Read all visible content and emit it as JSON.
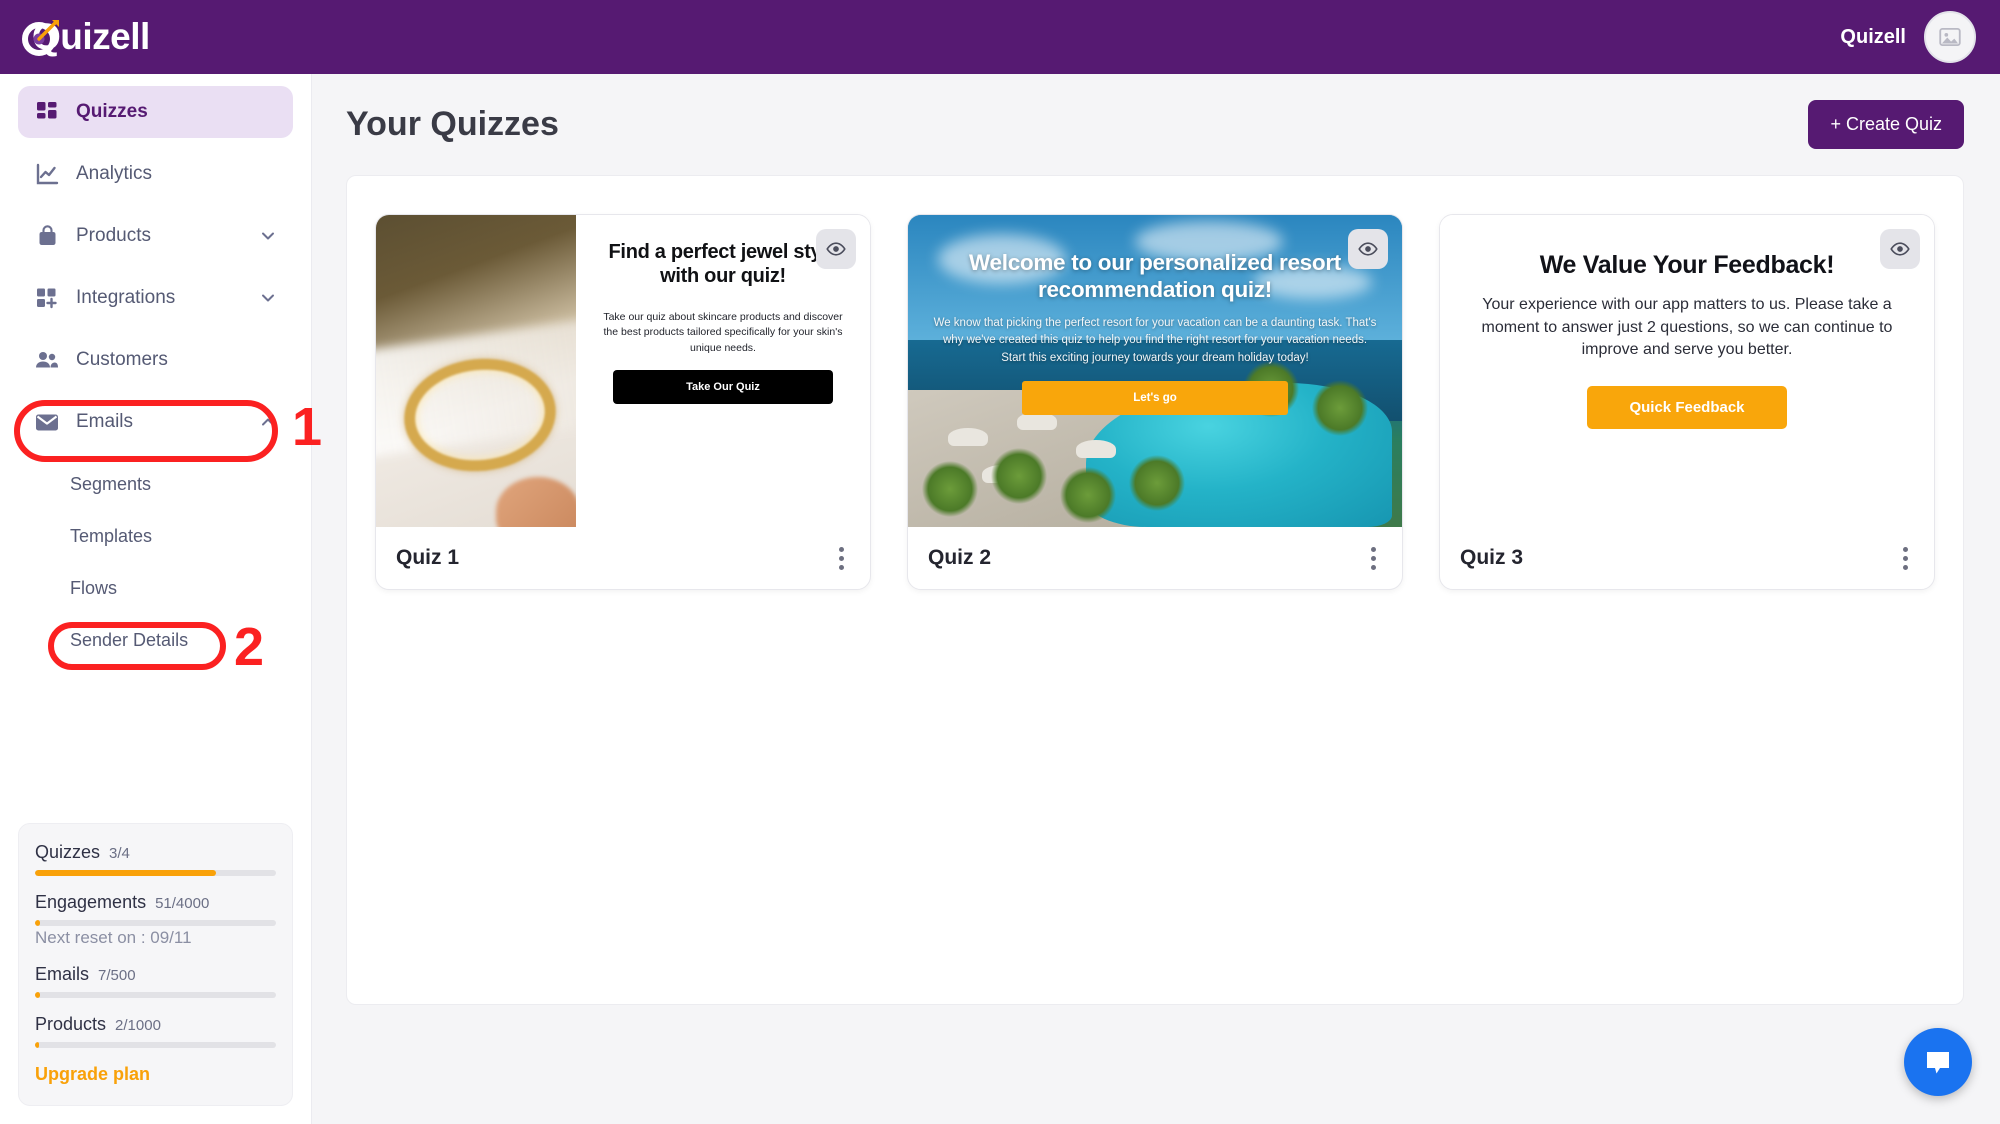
{
  "brand": {
    "name": "Quizell",
    "primary_color": "#561a72",
    "accent_color": "#f9a109"
  },
  "topbar": {
    "logo_text": "Quizell",
    "user_name": "Quizell"
  },
  "sidebar": {
    "items": [
      {
        "label": "Quizzes",
        "icon": "grid-icon",
        "active": true,
        "expandable": false
      },
      {
        "label": "Analytics",
        "icon": "chart-line-icon",
        "active": false,
        "expandable": false
      },
      {
        "label": "Products",
        "icon": "bag-icon",
        "active": false,
        "expandable": true,
        "expanded": false
      },
      {
        "label": "Integrations",
        "icon": "integrations-icon",
        "active": false,
        "expandable": true,
        "expanded": false
      },
      {
        "label": "Customers",
        "icon": "users-icon",
        "active": false,
        "expandable": false
      },
      {
        "label": "Emails",
        "icon": "envelope-icon",
        "active": false,
        "expandable": true,
        "expanded": true
      }
    ],
    "email_subitems": [
      {
        "label": "Segments"
      },
      {
        "label": "Templates"
      },
      {
        "label": "Flows"
      },
      {
        "label": "Sender Details"
      }
    ],
    "usage": {
      "rows": [
        {
          "name": "Quizzes",
          "value": "3/4",
          "percent": 75
        },
        {
          "name": "Engagements",
          "value": "51/4000",
          "percent": 2
        },
        {
          "name": "Emails",
          "value": "7/500",
          "percent": 2
        },
        {
          "name": "Products",
          "value": "2/1000",
          "percent": 1.5
        }
      ],
      "reset_note": "Next reset on : 09/11",
      "upgrade_label": "Upgrade plan"
    }
  },
  "main": {
    "page_title": "Your Quizzes",
    "create_button": "+ Create Quiz",
    "quizzes": [
      {
        "name": "Quiz 1",
        "preview_type": "split-image",
        "title": "Find a perfect jewel style with our quiz!",
        "description": "Take our quiz about skincare products and discover the best products tailored specifically for your skin's unique needs.",
        "cta": "Take Our Quiz",
        "cta_color": "#000000",
        "image_subject": "gold chain bracelet on magazine"
      },
      {
        "name": "Quiz 2",
        "preview_type": "full-bleed-image",
        "title": "Welcome to our personalized resort recommendation quiz!",
        "description": "We know that picking the perfect resort for your vacation can be a daunting task. That's why we've created this quiz to help you find the right resort for your vacation needs. Start this exciting journey towards your dream holiday today!",
        "cta": "Let's go",
        "cta_color": "#f9a60b",
        "image_subject": "tropical resort pool with palm trees"
      },
      {
        "name": "Quiz 3",
        "preview_type": "plain",
        "title": "We Value Your Feedback!",
        "description": "Your experience with our app matters to us. Please take a moment to answer just 2 questions, so we can continue to improve and serve you better.",
        "cta": "Quick Feedback",
        "cta_color": "#f9a60b",
        "image_subject": ""
      }
    ],
    "card_menu_icon": "vertical-dots-icon",
    "preview_icon": "eye-icon"
  },
  "annotations": [
    {
      "number": "1",
      "target": "Emails"
    },
    {
      "number": "2",
      "target": "Sender Details"
    }
  ],
  "chat_widget": {
    "icon": "chat-bubble-icon",
    "color": "#1a73f0"
  }
}
